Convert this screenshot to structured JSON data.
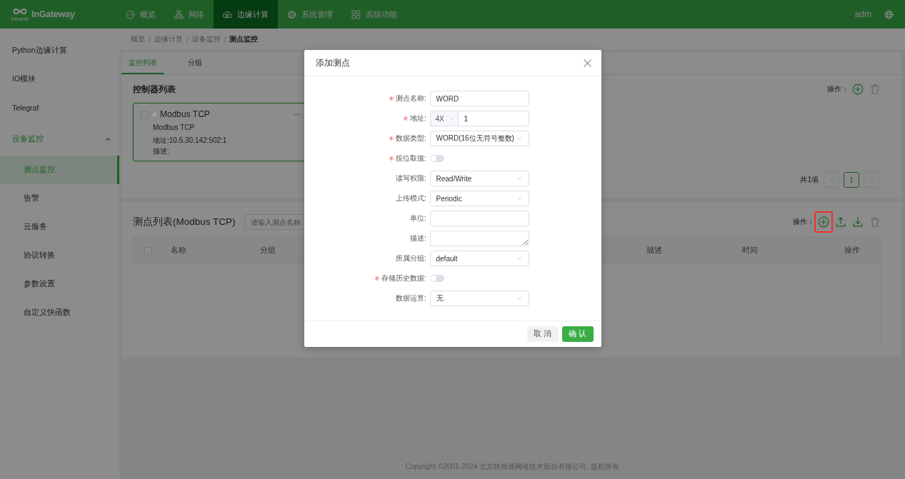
{
  "header": {
    "logo_sub": "inhand",
    "logo": "InGateway",
    "nav": [
      {
        "label": "概览",
        "selected": false
      },
      {
        "label": "网络",
        "selected": false
      },
      {
        "label": "边缘计算",
        "selected": true
      },
      {
        "label": "系统管理",
        "selected": false
      },
      {
        "label": "高级功能",
        "selected": false
      }
    ],
    "user": "adm"
  },
  "sidebar": {
    "items": [
      {
        "label": "Python边缘计算",
        "selected": false
      },
      {
        "label": "IO模块",
        "selected": false
      },
      {
        "label": "Telegraf",
        "selected": false
      },
      {
        "label": "设备监控",
        "expanded": true,
        "children": [
          {
            "label": "测点监控",
            "selected": true
          },
          {
            "label": "告警",
            "selected": false
          },
          {
            "label": "云服务",
            "selected": false
          },
          {
            "label": "协议转换",
            "selected": false
          },
          {
            "label": "参数设置",
            "selected": false
          },
          {
            "label": "自定义快函数",
            "selected": false
          }
        ]
      }
    ]
  },
  "breadcrumb": {
    "separator": "/",
    "items": [
      "概览",
      "边缘计算",
      "设备监控",
      "测点监控"
    ]
  },
  "controller_panel": {
    "tabs": [
      {
        "label": "监控列表",
        "selected": true
      },
      {
        "label": "分组",
        "selected": false
      }
    ],
    "title": "控制器列表",
    "actions_label": "操作：",
    "actions": [
      {
        "kind": "add",
        "disabled": false
      },
      {
        "kind": "delete",
        "disabled": true
      }
    ],
    "controllers": [
      {
        "name": "Modbus TCP",
        "protocol": "Modbus TCP",
        "address": "地址:10.5.30.142:502:1",
        "description": "描述:",
        "selected": true,
        "checked": false,
        "color": "#a8a8a8"
      }
    ],
    "pagination": {
      "total": "共1项",
      "prev_disabled": true,
      "next_disabled": true,
      "pages": [
        {
          "label": "1",
          "selected": true
        }
      ]
    }
  },
  "point_list": {
    "title": "测点列表(Modbus TCP)",
    "search": {
      "placeholder": "请输入测点名称"
    },
    "actions_label": "操作：",
    "actions": [
      {
        "kind": "add",
        "disabled": false,
        "highlighted": true
      },
      {
        "kind": "upload",
        "disabled": false,
        "highlighted": false
      },
      {
        "kind": "download",
        "disabled": false,
        "highlighted": false
      },
      {
        "kind": "delete",
        "disabled": true,
        "highlighted": false
      }
    ],
    "table": {
      "select_all_checked": false,
      "columns": [
        "名称",
        "分组",
        "描述",
        "时间",
        "操作"
      ]
    }
  },
  "modal": {
    "title": "添加测点",
    "fields": [
      {
        "label": "测点名称:",
        "required": true,
        "kind": "input",
        "value": "WORD"
      },
      {
        "label": "地址:",
        "required": true,
        "kind": "address",
        "prefix": "4X",
        "value": "1"
      },
      {
        "label": "数据类型:",
        "required": true,
        "kind": "select",
        "value": "WORD(16位无符号整数)"
      },
      {
        "label": "按位取值:",
        "required": true,
        "kind": "switch",
        "on": false
      },
      {
        "label": "读写权限:",
        "required": false,
        "kind": "select",
        "value": "Read/Write"
      },
      {
        "label": "上传模式:",
        "required": false,
        "kind": "select",
        "value": "Periodic"
      },
      {
        "label": "单位:",
        "required": false,
        "kind": "input"
      },
      {
        "label": "描述:",
        "required": false,
        "kind": "textarea"
      },
      {
        "label": "所属分组:",
        "required": false,
        "kind": "select",
        "value": "default"
      },
      {
        "label": "存储历史数据:",
        "required": true,
        "kind": "switch",
        "on": false
      },
      {
        "label": "数据运算:",
        "required": false,
        "kind": "select",
        "value": "无"
      }
    ],
    "buttons": [
      {
        "label": "取 消",
        "kind": "default"
      },
      {
        "label": "确 认",
        "kind": "primary"
      }
    ]
  },
  "footer": "Copyright ©2001-2024 北京映翰通网络技术股份有限公司. 版权所有"
}
